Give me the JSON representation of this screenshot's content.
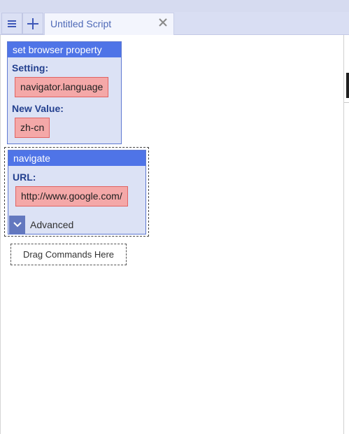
{
  "tabbar": {
    "tab_title": "Untitled Script"
  },
  "commands": [
    {
      "name": "set browser property",
      "fields": [
        {
          "label": "Setting:",
          "value": "navigator.language"
        },
        {
          "label": "New Value:",
          "value": "zh-cn"
        }
      ]
    },
    {
      "name": "navigate",
      "fields": [
        {
          "label": "URL:",
          "value": "http://www.google.com/"
        }
      ],
      "advanced_label": "Advanced"
    }
  ],
  "drop_zone": {
    "label": "Drag Commands Here"
  },
  "colors": {
    "header_blue": "#4f74e7",
    "command_bg": "#dce2f5",
    "value_red": "#f4a8a8",
    "label_navy": "#23408f"
  },
  "icons": {
    "menu": "hamburger-icon",
    "add": "plus-icon",
    "close": "close-icon",
    "advanced": "chevron-down-icon"
  }
}
